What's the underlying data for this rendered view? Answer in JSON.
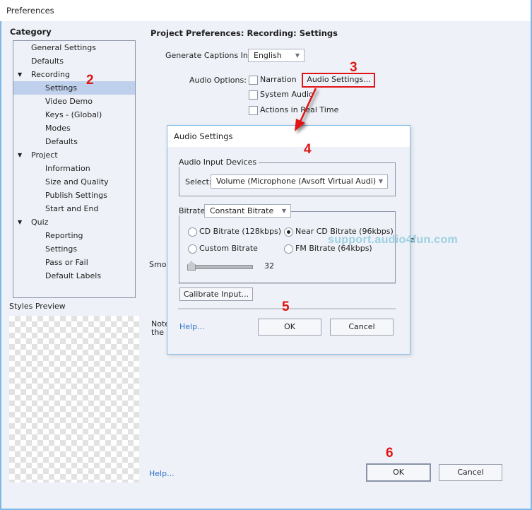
{
  "window": {
    "title": "Preferences"
  },
  "sidebar": {
    "category_label": "Category",
    "items": [
      {
        "label": "General Settings",
        "level": 0,
        "expanded": null,
        "selected": false
      },
      {
        "label": "Defaults",
        "level": 0,
        "expanded": null,
        "selected": false
      },
      {
        "label": "Recording",
        "level": 0,
        "expanded": true,
        "selected": false
      },
      {
        "label": "Settings",
        "level": 1,
        "expanded": null,
        "selected": true
      },
      {
        "label": "Video Demo",
        "level": 1,
        "expanded": null,
        "selected": false
      },
      {
        "label": "Keys - (Global)",
        "level": 1,
        "expanded": null,
        "selected": false
      },
      {
        "label": "Modes",
        "level": 1,
        "expanded": null,
        "selected": false
      },
      {
        "label": "Defaults",
        "level": 1,
        "expanded": null,
        "selected": false
      },
      {
        "label": "Project",
        "level": 0,
        "expanded": true,
        "selected": false
      },
      {
        "label": "Information",
        "level": 1,
        "expanded": null,
        "selected": false
      },
      {
        "label": "Size and Quality",
        "level": 1,
        "expanded": null,
        "selected": false
      },
      {
        "label": "Publish Settings",
        "level": 1,
        "expanded": null,
        "selected": false
      },
      {
        "label": "Start and End",
        "level": 1,
        "expanded": null,
        "selected": false
      },
      {
        "label": "Quiz",
        "level": 0,
        "expanded": true,
        "selected": false
      },
      {
        "label": "Reporting",
        "level": 1,
        "expanded": null,
        "selected": false
      },
      {
        "label": "Settings",
        "level": 1,
        "expanded": null,
        "selected": false
      },
      {
        "label": "Pass or Fail",
        "level": 1,
        "expanded": null,
        "selected": false
      },
      {
        "label": "Default Labels",
        "level": 1,
        "expanded": null,
        "selected": false
      }
    ],
    "expand_icon": "▼",
    "styles_preview_label": "Styles Preview"
  },
  "main": {
    "heading": "Project Preferences: Recording: Settings",
    "captions_label": "Generate Captions In:",
    "captions_value": "English",
    "audio_options_label": "Audio Options:",
    "audio_options": [
      {
        "label": "Narration",
        "checked": false
      },
      {
        "label": "System Audio",
        "checked": false
      },
      {
        "label": "Actions in Real Time",
        "checked": false
      }
    ],
    "audio_settings_button": "Audio Settings...",
    "partial_smooth_label": "Smoo",
    "partial_note_line1": "Note",
    "partial_note_line2": "the F",
    "partial_right_char": "a",
    "help_link": "Help...",
    "ok_button": "OK",
    "cancel_button": "Cancel"
  },
  "audio_dialog": {
    "title": "Audio Settings",
    "input_devices_legend": "Audio Input Devices",
    "select_label": "Select:",
    "select_value": "Volume (Microphone (Avsoft Virtual Audi)",
    "bitrate_label": "Bitrate",
    "bitrate_mode": "Constant Bitrate",
    "bitrate_options": [
      {
        "label": "CD Bitrate (128kbps)",
        "checked": false
      },
      {
        "label": "Near CD Bitrate (96kbps)",
        "checked": true
      },
      {
        "label": "Custom Bitrate",
        "checked": false
      },
      {
        "label": "FM Bitrate (64kbps)",
        "checked": false
      }
    ],
    "custom_slider_value": "32",
    "calibrate_button": "Calibrate Input...",
    "help_link": "Help...",
    "ok_button": "OK",
    "cancel_button": "Cancel"
  },
  "annotations": {
    "steps": [
      "2",
      "3",
      "4",
      "5",
      "6"
    ],
    "watermark": "support.audio4fun.com",
    "color": "#e01515"
  }
}
